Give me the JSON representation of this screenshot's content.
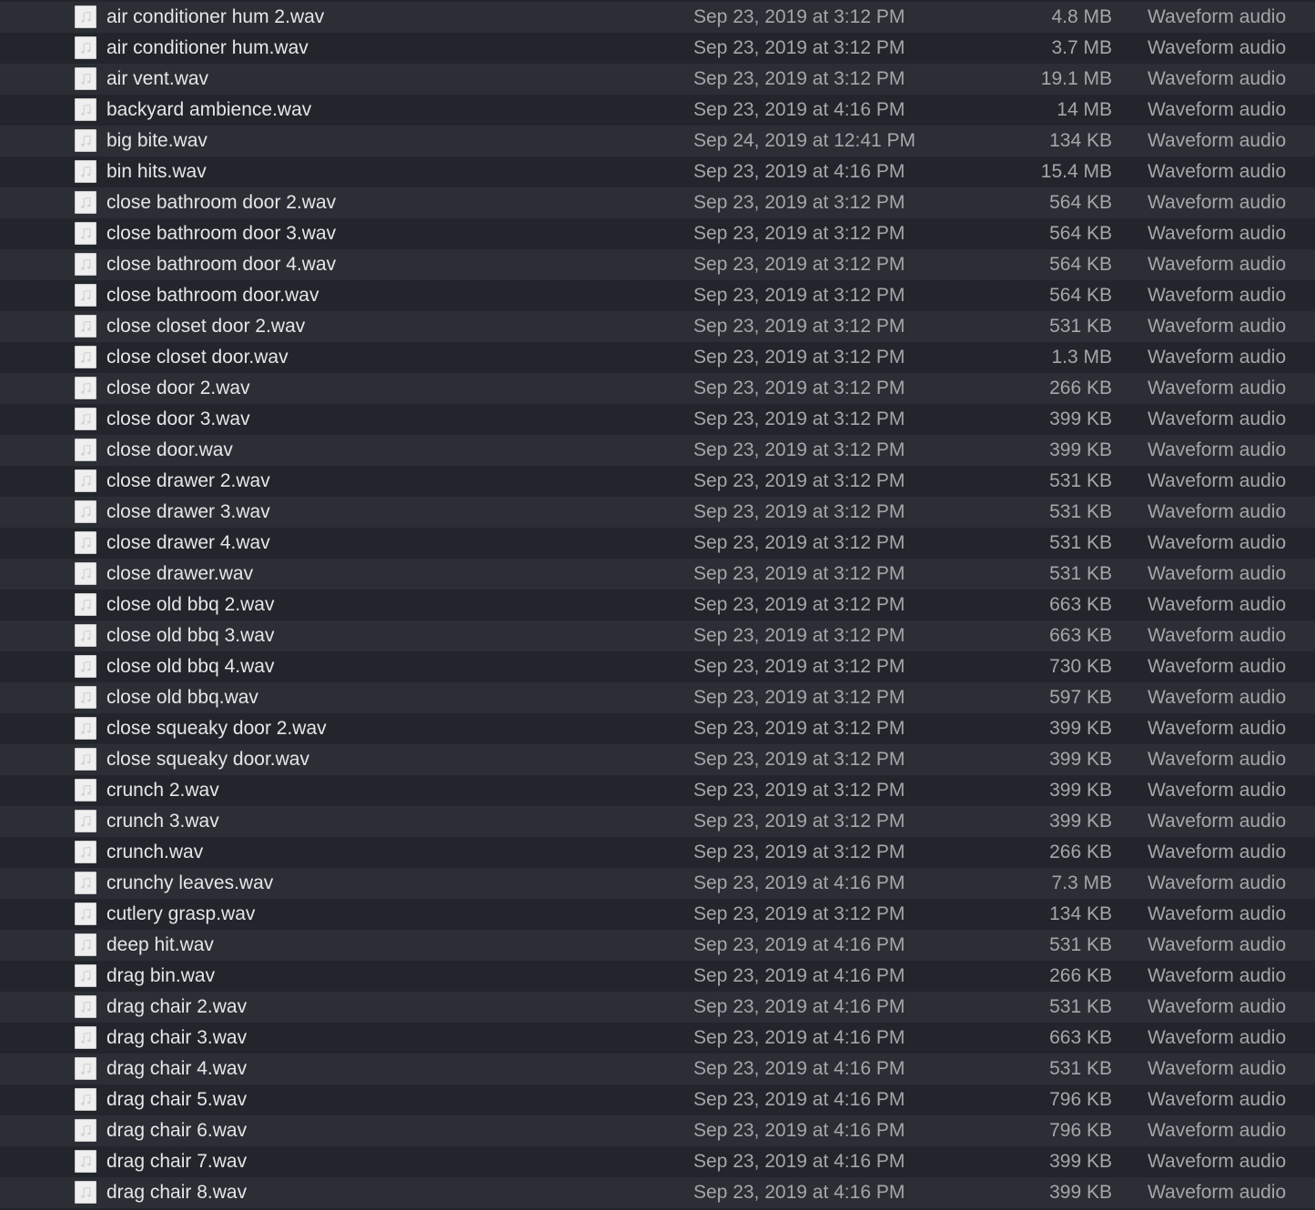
{
  "file_list": {
    "icon": "audio-file-icon",
    "rows": [
      {
        "name": "air conditioner hum 2.wav",
        "date": "Sep 23, 2019 at 3:12 PM",
        "size": "4.8 MB",
        "kind": "Waveform audio"
      },
      {
        "name": "air conditioner hum.wav",
        "date": "Sep 23, 2019 at 3:12 PM",
        "size": "3.7 MB",
        "kind": "Waveform audio"
      },
      {
        "name": "air vent.wav",
        "date": "Sep 23, 2019 at 3:12 PM",
        "size": "19.1 MB",
        "kind": "Waveform audio"
      },
      {
        "name": "backyard ambience.wav",
        "date": "Sep 23, 2019 at 4:16 PM",
        "size": "14 MB",
        "kind": "Waveform audio"
      },
      {
        "name": "big bite.wav",
        "date": "Sep 24, 2019 at 12:41 PM",
        "size": "134 KB",
        "kind": "Waveform audio"
      },
      {
        "name": "bin hits.wav",
        "date": "Sep 23, 2019 at 4:16 PM",
        "size": "15.4 MB",
        "kind": "Waveform audio"
      },
      {
        "name": "close bathroom door 2.wav",
        "date": "Sep 23, 2019 at 3:12 PM",
        "size": "564 KB",
        "kind": "Waveform audio"
      },
      {
        "name": "close bathroom door 3.wav",
        "date": "Sep 23, 2019 at 3:12 PM",
        "size": "564 KB",
        "kind": "Waveform audio"
      },
      {
        "name": "close bathroom door 4.wav",
        "date": "Sep 23, 2019 at 3:12 PM",
        "size": "564 KB",
        "kind": "Waveform audio"
      },
      {
        "name": "close bathroom door.wav",
        "date": "Sep 23, 2019 at 3:12 PM",
        "size": "564 KB",
        "kind": "Waveform audio"
      },
      {
        "name": "close closet door 2.wav",
        "date": "Sep 23, 2019 at 3:12 PM",
        "size": "531 KB",
        "kind": "Waveform audio"
      },
      {
        "name": "close closet door.wav",
        "date": "Sep 23, 2019 at 3:12 PM",
        "size": "1.3 MB",
        "kind": "Waveform audio"
      },
      {
        "name": "close door 2.wav",
        "date": "Sep 23, 2019 at 3:12 PM",
        "size": "266 KB",
        "kind": "Waveform audio"
      },
      {
        "name": "close door 3.wav",
        "date": "Sep 23, 2019 at 3:12 PM",
        "size": "399 KB",
        "kind": "Waveform audio"
      },
      {
        "name": "close door.wav",
        "date": "Sep 23, 2019 at 3:12 PM",
        "size": "399 KB",
        "kind": "Waveform audio"
      },
      {
        "name": "close drawer 2.wav",
        "date": "Sep 23, 2019 at 3:12 PM",
        "size": "531 KB",
        "kind": "Waveform audio"
      },
      {
        "name": "close drawer 3.wav",
        "date": "Sep 23, 2019 at 3:12 PM",
        "size": "531 KB",
        "kind": "Waveform audio"
      },
      {
        "name": "close drawer 4.wav",
        "date": "Sep 23, 2019 at 3:12 PM",
        "size": "531 KB",
        "kind": "Waveform audio"
      },
      {
        "name": "close drawer.wav",
        "date": "Sep 23, 2019 at 3:12 PM",
        "size": "531 KB",
        "kind": "Waveform audio"
      },
      {
        "name": "close old bbq 2.wav",
        "date": "Sep 23, 2019 at 3:12 PM",
        "size": "663 KB",
        "kind": "Waveform audio"
      },
      {
        "name": "close old bbq 3.wav",
        "date": "Sep 23, 2019 at 3:12 PM",
        "size": "663 KB",
        "kind": "Waveform audio"
      },
      {
        "name": "close old bbq 4.wav",
        "date": "Sep 23, 2019 at 3:12 PM",
        "size": "730 KB",
        "kind": "Waveform audio"
      },
      {
        "name": "close old bbq.wav",
        "date": "Sep 23, 2019 at 3:12 PM",
        "size": "597 KB",
        "kind": "Waveform audio"
      },
      {
        "name": "close squeaky door 2.wav",
        "date": "Sep 23, 2019 at 3:12 PM",
        "size": "399 KB",
        "kind": "Waveform audio"
      },
      {
        "name": "close squeaky door.wav",
        "date": "Sep 23, 2019 at 3:12 PM",
        "size": "399 KB",
        "kind": "Waveform audio"
      },
      {
        "name": "crunch 2.wav",
        "date": "Sep 23, 2019 at 3:12 PM",
        "size": "399 KB",
        "kind": "Waveform audio"
      },
      {
        "name": "crunch 3.wav",
        "date": "Sep 23, 2019 at 3:12 PM",
        "size": "399 KB",
        "kind": "Waveform audio"
      },
      {
        "name": "crunch.wav",
        "date": "Sep 23, 2019 at 3:12 PM",
        "size": "266 KB",
        "kind": "Waveform audio"
      },
      {
        "name": "crunchy leaves.wav",
        "date": "Sep 23, 2019 at 4:16 PM",
        "size": "7.3 MB",
        "kind": "Waveform audio"
      },
      {
        "name": "cutlery grasp.wav",
        "date": "Sep 23, 2019 at 3:12 PM",
        "size": "134 KB",
        "kind": "Waveform audio"
      },
      {
        "name": "deep hit.wav",
        "date": "Sep 23, 2019 at 4:16 PM",
        "size": "531 KB",
        "kind": "Waveform audio"
      },
      {
        "name": "drag bin.wav",
        "date": "Sep 23, 2019 at 4:16 PM",
        "size": "266 KB",
        "kind": "Waveform audio"
      },
      {
        "name": "drag chair 2.wav",
        "date": "Sep 23, 2019 at 4:16 PM",
        "size": "531 KB",
        "kind": "Waveform audio"
      },
      {
        "name": "drag chair 3.wav",
        "date": "Sep 23, 2019 at 4:16 PM",
        "size": "663 KB",
        "kind": "Waveform audio"
      },
      {
        "name": "drag chair 4.wav",
        "date": "Sep 23, 2019 at 4:16 PM",
        "size": "531 KB",
        "kind": "Waveform audio"
      },
      {
        "name": "drag chair 5.wav",
        "date": "Sep 23, 2019 at 4:16 PM",
        "size": "796 KB",
        "kind": "Waveform audio"
      },
      {
        "name": "drag chair 6.wav",
        "date": "Sep 23, 2019 at 4:16 PM",
        "size": "796 KB",
        "kind": "Waveform audio"
      },
      {
        "name": "drag chair 7.wav",
        "date": "Sep 23, 2019 at 4:16 PM",
        "size": "399 KB",
        "kind": "Waveform audio"
      },
      {
        "name": "drag chair 8.wav",
        "date": "Sep 23, 2019 at 4:16 PM",
        "size": "399 KB",
        "kind": "Waveform audio"
      }
    ]
  }
}
